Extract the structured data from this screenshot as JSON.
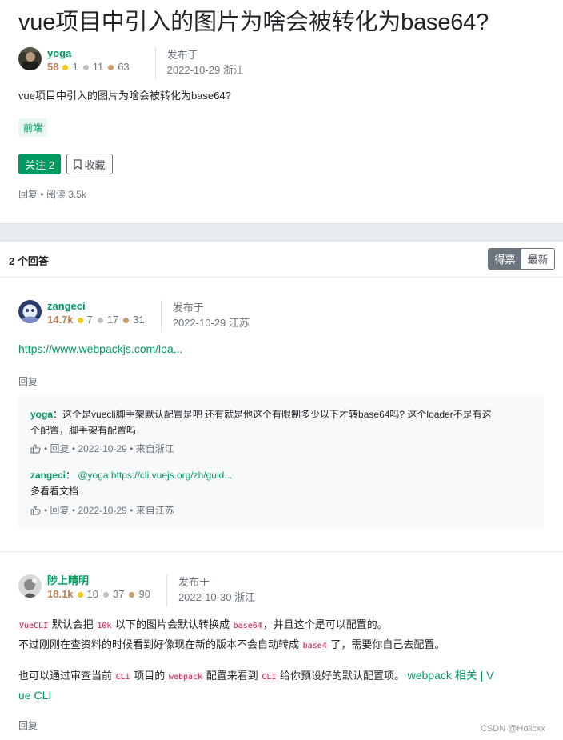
{
  "question": {
    "title": "vue项目中引入的图片为啥会被转化为base64?",
    "author": {
      "name": "yoga",
      "reputation": "58",
      "gold": "1",
      "silver": "11",
      "bronze": "63"
    },
    "published_label": "发布于",
    "published_time": "2022-10-29 浙江",
    "body": "vue项目中引入的图片为啥会被转化为base64?",
    "tag": "前端",
    "follow_label": "关注 2",
    "collect_label": "收藏",
    "reply_label": "回复",
    "read_label": "阅读 3.5k"
  },
  "answers_header": {
    "title": "2 个回答",
    "sort_votes": "得票",
    "sort_newest": "最新"
  },
  "answers": [
    {
      "author": {
        "name": "zangeci",
        "reputation": "14.7k",
        "gold": "7",
        "silver": "17",
        "bronze": "31"
      },
      "published_label": "发布于",
      "published_time": "2022-10-29 江苏",
      "link_text": "https://www.webpackjs.com/loa...",
      "reply_label": "回复",
      "comments": [
        {
          "author": "yoga",
          "text_line1": "这个是vuecli脚手架默认配置是吧 还有就是他这个有限制多少以下才转base64吗? 这个loader不是有这",
          "text_line2": "个配置，脚手架有配置吗",
          "reply": "回复",
          "time": "2022-10-29",
          "location": "来自浙江"
        },
        {
          "author": "zangeci",
          "mention": "@yoga https://cli.vuejs.org/zh/guid...",
          "text_line2": "多看看文档",
          "reply": "回复",
          "time": "2022-10-29",
          "location": "来自江苏"
        }
      ]
    },
    {
      "author": {
        "name": "陟上晴明",
        "reputation": "18.1k",
        "gold": "10",
        "silver": "37",
        "bronze": "90"
      },
      "published_label": "发布于",
      "published_time": "2022-10-30 浙江",
      "body": {
        "p1_code1": "VueCLI",
        "p1_t1": " 默认会把 ",
        "p1_code2": "10k",
        "p1_t2": " 以下的图片会默认转换成 ",
        "p1_code3": "base64",
        "p1_t3": "，并且这个是可以配置的。",
        "p2_t1": "不过刚刚在查资料的时候看到好像现在新的版本不会自动转成 ",
        "p2_code1": "base4",
        "p2_t2": " 了，需要你自己去配置。",
        "p3_t1": "也可以通过审查当前 ",
        "p3_code1": "CLi",
        "p3_t2": " 项目的 ",
        "p3_code2": "webpack",
        "p3_t3": " 配置来看到 ",
        "p3_code3": "CLI",
        "p3_t4": " 给你预设好的默认配置项。 ",
        "p3_link_a": "webpack 相关 | V",
        "p3_link_b": "ue CLI"
      },
      "reply_label": "回复"
    }
  ],
  "watermark": "CSDN @Holicxx",
  "colors": {
    "brand_green": "#009a61",
    "sort_active": "#6c757d",
    "code_red": "#c7254e"
  }
}
